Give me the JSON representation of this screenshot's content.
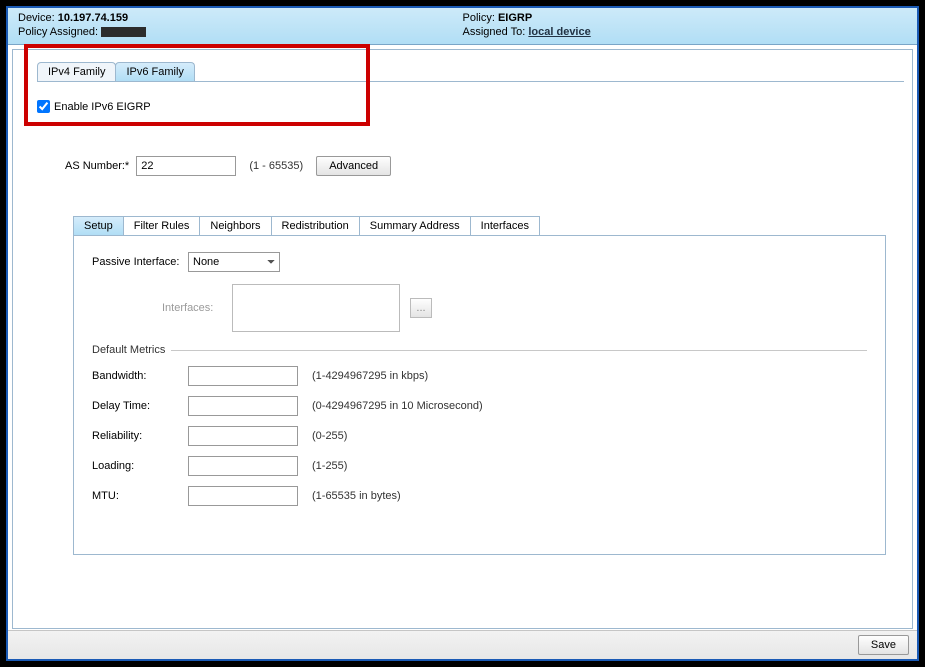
{
  "header": {
    "device_label": "Device:",
    "device_value": "10.197.74.159",
    "policy_assigned_label": "Policy Assigned:",
    "policy_label": "Policy:",
    "policy_value": "EIGRP",
    "assigned_to_label": "Assigned To:",
    "assigned_to_value": "local device"
  },
  "family_tabs": {
    "ipv4": "IPv4 Family",
    "ipv6": "IPv6 Family"
  },
  "enable_checkbox_label": "Enable IPv6 EIGRP",
  "as_section": {
    "label": "AS Number:*",
    "value": "22",
    "range": "(1 - 65535)",
    "advanced_btn": "Advanced"
  },
  "sub_tabs": {
    "setup": "Setup",
    "filter_rules": "Filter Rules",
    "neighbors": "Neighbors",
    "redistribution": "Redistribution",
    "summary_address": "Summary Address",
    "interfaces": "Interfaces"
  },
  "setup_panel": {
    "passive_interface_label": "Passive Interface:",
    "passive_interface_value": "None",
    "interfaces_label": "Interfaces:",
    "ellipsis": "...",
    "default_metrics_title": "Default Metrics",
    "metrics": {
      "bandwidth_label": "Bandwidth:",
      "bandwidth_hint": "(1-4294967295 in kbps)",
      "delay_label": "Delay Time:",
      "delay_hint": "(0-4294967295 in 10 Microsecond)",
      "reliability_label": "Reliability:",
      "reliability_hint": "(0-255)",
      "loading_label": "Loading:",
      "loading_hint": "(1-255)",
      "mtu_label": "MTU:",
      "mtu_hint": "(1-65535 in bytes)"
    }
  },
  "footer": {
    "save_btn": "Save"
  }
}
